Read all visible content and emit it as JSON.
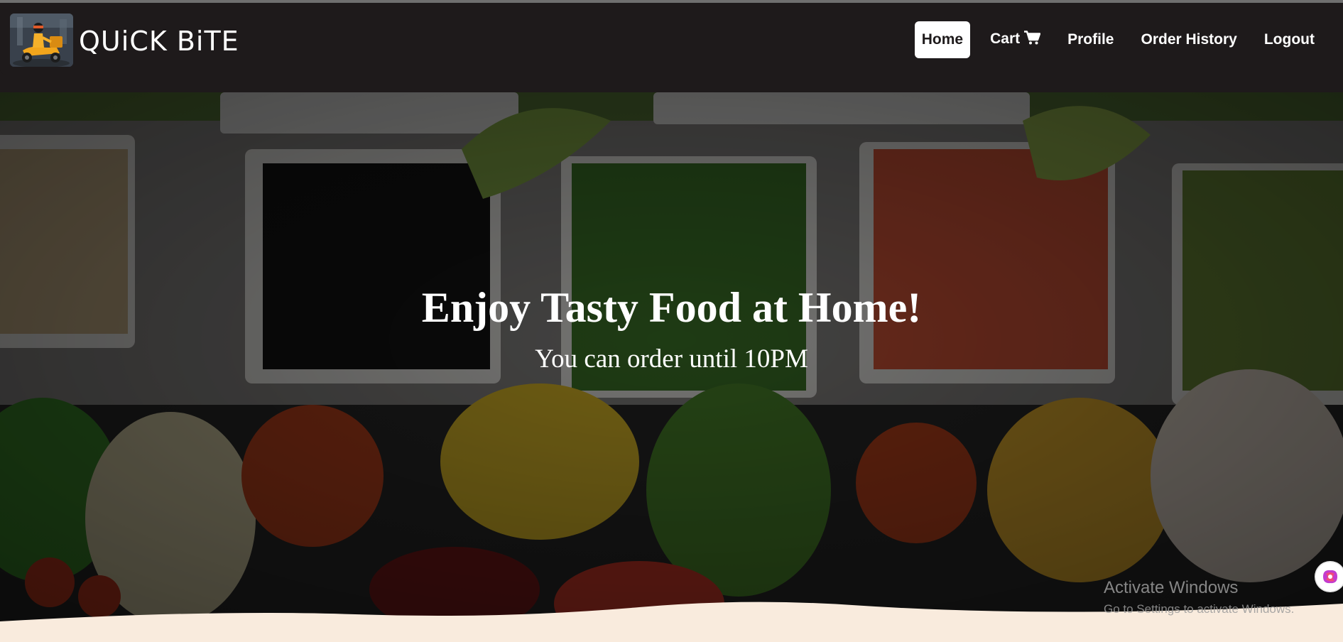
{
  "brand": {
    "name": "QUiCK BiTE",
    "logo_icon": "delivery-scooter-icon"
  },
  "nav": {
    "items": [
      {
        "label": "Home",
        "active": true
      },
      {
        "label": "Cart",
        "icon": "cart-icon"
      },
      {
        "label": "Profile"
      },
      {
        "label": "Order History"
      },
      {
        "label": "Logout"
      }
    ]
  },
  "hero": {
    "title": "Enjoy Tasty Food at Home!",
    "subtitle": "You can order until 10PM"
  },
  "os_watermark": {
    "title": "Activate Windows",
    "subtitle": "Go to Settings to activate Windows."
  },
  "colors": {
    "navbar_bg": "#1e1a1b",
    "active_nav_bg": "#ffffff",
    "wave_fill": "#f9ebdd"
  }
}
